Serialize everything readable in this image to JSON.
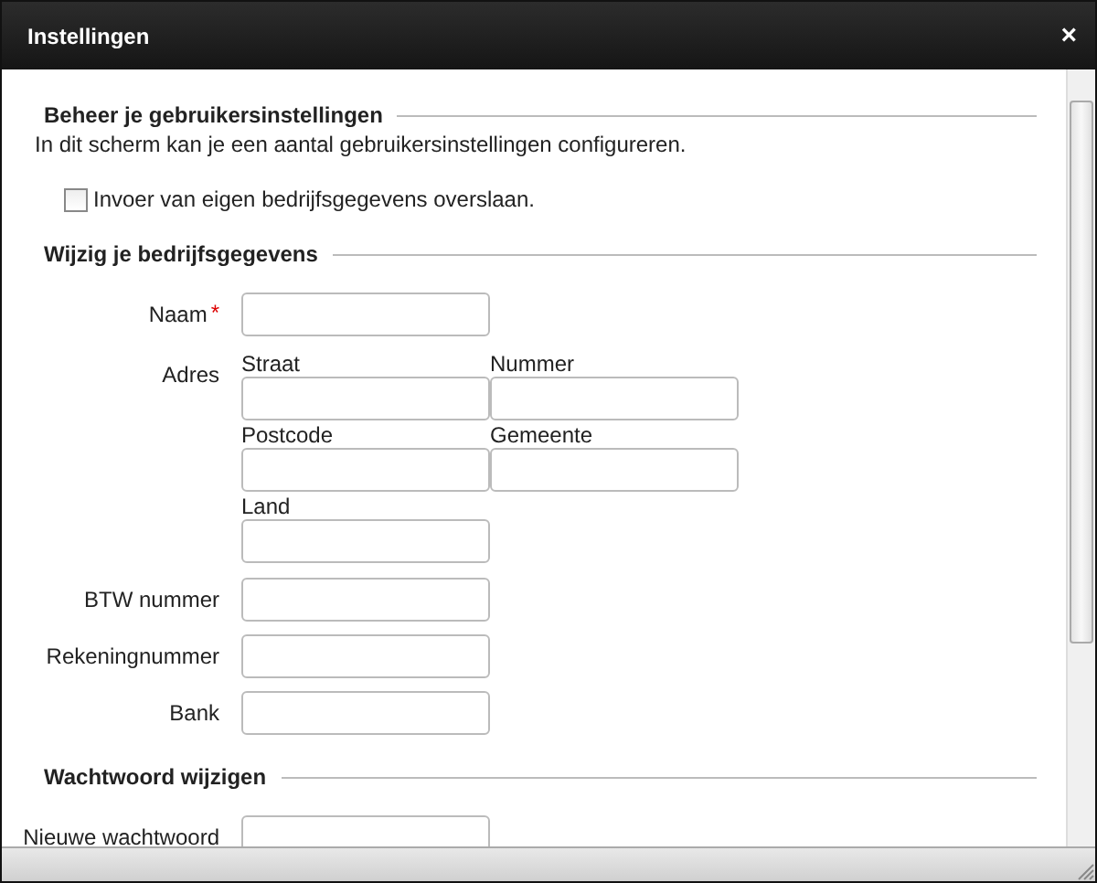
{
  "window": {
    "title": "Instellingen",
    "close": "×"
  },
  "sections": [
    {
      "title": "Beheer je gebruikersinstellingen",
      "description": "In dit scherm kan je een aantal gebruikersinstellingen configureren.",
      "checkbox": {
        "label": "Invoer van eigen bedrijfsgegevens overslaan.",
        "checked": false
      }
    },
    {
      "title": "Wijzig je bedrijfsgegevens",
      "fields": [
        {
          "kind": "text",
          "label": "Naam",
          "marker": "*"
        },
        {
          "kind": "address",
          "label": "Adres",
          "parts": [
            "Straat",
            "Nummer",
            "Postcode",
            "Gemeente",
            "Land"
          ]
        },
        {
          "kind": "text",
          "label": "BTW nummer"
        },
        {
          "kind": "text",
          "label": "Rekeningnummer"
        },
        {
          "kind": "text",
          "label": "Bank"
        }
      ]
    },
    {
      "title": "Wachtwoord wijzigen",
      "fields": [
        {
          "kind": "text",
          "label": "Nieuwe wachtwoord"
        }
      ]
    }
  ]
}
